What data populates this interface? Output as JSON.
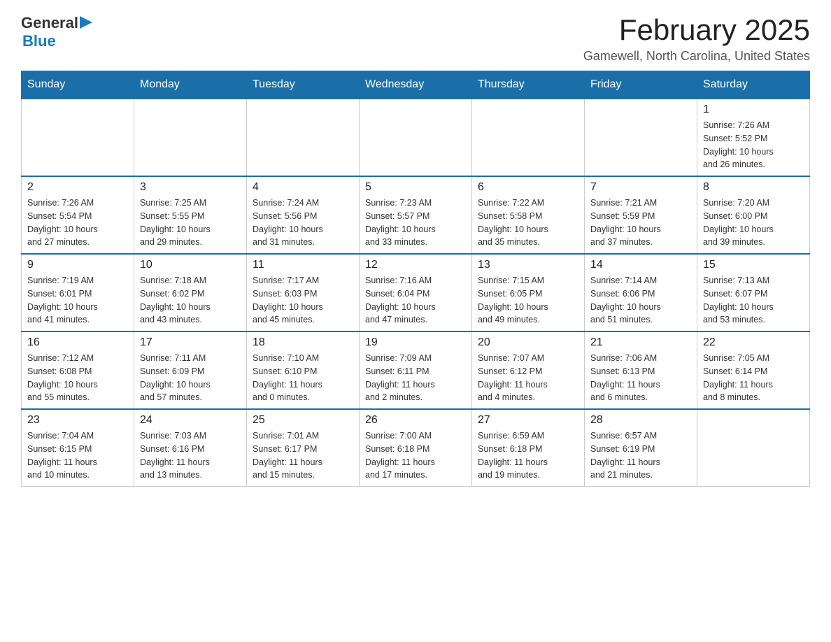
{
  "logo": {
    "text_general": "General",
    "text_blue": "Blue"
  },
  "title": "February 2025",
  "location": "Gamewell, North Carolina, United States",
  "days_of_week": [
    "Sunday",
    "Monday",
    "Tuesday",
    "Wednesday",
    "Thursday",
    "Friday",
    "Saturday"
  ],
  "weeks": [
    [
      {
        "day": "",
        "info": ""
      },
      {
        "day": "",
        "info": ""
      },
      {
        "day": "",
        "info": ""
      },
      {
        "day": "",
        "info": ""
      },
      {
        "day": "",
        "info": ""
      },
      {
        "day": "",
        "info": ""
      },
      {
        "day": "1",
        "info": "Sunrise: 7:26 AM\nSunset: 5:52 PM\nDaylight: 10 hours\nand 26 minutes."
      }
    ],
    [
      {
        "day": "2",
        "info": "Sunrise: 7:26 AM\nSunset: 5:54 PM\nDaylight: 10 hours\nand 27 minutes."
      },
      {
        "day": "3",
        "info": "Sunrise: 7:25 AM\nSunset: 5:55 PM\nDaylight: 10 hours\nand 29 minutes."
      },
      {
        "day": "4",
        "info": "Sunrise: 7:24 AM\nSunset: 5:56 PM\nDaylight: 10 hours\nand 31 minutes."
      },
      {
        "day": "5",
        "info": "Sunrise: 7:23 AM\nSunset: 5:57 PM\nDaylight: 10 hours\nand 33 minutes."
      },
      {
        "day": "6",
        "info": "Sunrise: 7:22 AM\nSunset: 5:58 PM\nDaylight: 10 hours\nand 35 minutes."
      },
      {
        "day": "7",
        "info": "Sunrise: 7:21 AM\nSunset: 5:59 PM\nDaylight: 10 hours\nand 37 minutes."
      },
      {
        "day": "8",
        "info": "Sunrise: 7:20 AM\nSunset: 6:00 PM\nDaylight: 10 hours\nand 39 minutes."
      }
    ],
    [
      {
        "day": "9",
        "info": "Sunrise: 7:19 AM\nSunset: 6:01 PM\nDaylight: 10 hours\nand 41 minutes."
      },
      {
        "day": "10",
        "info": "Sunrise: 7:18 AM\nSunset: 6:02 PM\nDaylight: 10 hours\nand 43 minutes."
      },
      {
        "day": "11",
        "info": "Sunrise: 7:17 AM\nSunset: 6:03 PM\nDaylight: 10 hours\nand 45 minutes."
      },
      {
        "day": "12",
        "info": "Sunrise: 7:16 AM\nSunset: 6:04 PM\nDaylight: 10 hours\nand 47 minutes."
      },
      {
        "day": "13",
        "info": "Sunrise: 7:15 AM\nSunset: 6:05 PM\nDaylight: 10 hours\nand 49 minutes."
      },
      {
        "day": "14",
        "info": "Sunrise: 7:14 AM\nSunset: 6:06 PM\nDaylight: 10 hours\nand 51 minutes."
      },
      {
        "day": "15",
        "info": "Sunrise: 7:13 AM\nSunset: 6:07 PM\nDaylight: 10 hours\nand 53 minutes."
      }
    ],
    [
      {
        "day": "16",
        "info": "Sunrise: 7:12 AM\nSunset: 6:08 PM\nDaylight: 10 hours\nand 55 minutes."
      },
      {
        "day": "17",
        "info": "Sunrise: 7:11 AM\nSunset: 6:09 PM\nDaylight: 10 hours\nand 57 minutes."
      },
      {
        "day": "18",
        "info": "Sunrise: 7:10 AM\nSunset: 6:10 PM\nDaylight: 11 hours\nand 0 minutes."
      },
      {
        "day": "19",
        "info": "Sunrise: 7:09 AM\nSunset: 6:11 PM\nDaylight: 11 hours\nand 2 minutes."
      },
      {
        "day": "20",
        "info": "Sunrise: 7:07 AM\nSunset: 6:12 PM\nDaylight: 11 hours\nand 4 minutes."
      },
      {
        "day": "21",
        "info": "Sunrise: 7:06 AM\nSunset: 6:13 PM\nDaylight: 11 hours\nand 6 minutes."
      },
      {
        "day": "22",
        "info": "Sunrise: 7:05 AM\nSunset: 6:14 PM\nDaylight: 11 hours\nand 8 minutes."
      }
    ],
    [
      {
        "day": "23",
        "info": "Sunrise: 7:04 AM\nSunset: 6:15 PM\nDaylight: 11 hours\nand 10 minutes."
      },
      {
        "day": "24",
        "info": "Sunrise: 7:03 AM\nSunset: 6:16 PM\nDaylight: 11 hours\nand 13 minutes."
      },
      {
        "day": "25",
        "info": "Sunrise: 7:01 AM\nSunset: 6:17 PM\nDaylight: 11 hours\nand 15 minutes."
      },
      {
        "day": "26",
        "info": "Sunrise: 7:00 AM\nSunset: 6:18 PM\nDaylight: 11 hours\nand 17 minutes."
      },
      {
        "day": "27",
        "info": "Sunrise: 6:59 AM\nSunset: 6:18 PM\nDaylight: 11 hours\nand 19 minutes."
      },
      {
        "day": "28",
        "info": "Sunrise: 6:57 AM\nSunset: 6:19 PM\nDaylight: 11 hours\nand 21 minutes."
      },
      {
        "day": "",
        "info": ""
      }
    ]
  ]
}
